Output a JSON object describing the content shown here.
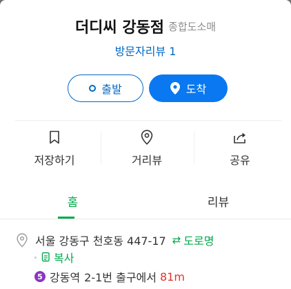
{
  "place": {
    "name": "더디씨 강동점",
    "category": "종합도소매"
  },
  "review_link": "방문자리뷰 1",
  "buttons": {
    "depart": "출발",
    "arrive": "도착"
  },
  "actions": [
    {
      "label": "저장하기",
      "icon": "bookmark-icon"
    },
    {
      "label": "거리뷰",
      "icon": "street-view-pin-icon"
    },
    {
      "label": "공유",
      "icon": "share-icon"
    }
  ],
  "tabs": [
    {
      "label": "홈",
      "active": true
    },
    {
      "label": "리뷰",
      "active": false
    }
  ],
  "address": {
    "text": "서울 강동구 천호동 447-17",
    "road_toggle": "도로명",
    "copy": "복사"
  },
  "subway": {
    "line": "5",
    "station": "강동역",
    "exit": "2-1번 출구에서",
    "distance": "81m",
    "line_color": "#8a36c0"
  },
  "colors": {
    "accent_blue": "#0068c3",
    "arrive_blue": "#0a78f0",
    "accent_green": "#03a94d",
    "distance_red": "#e4322b"
  }
}
